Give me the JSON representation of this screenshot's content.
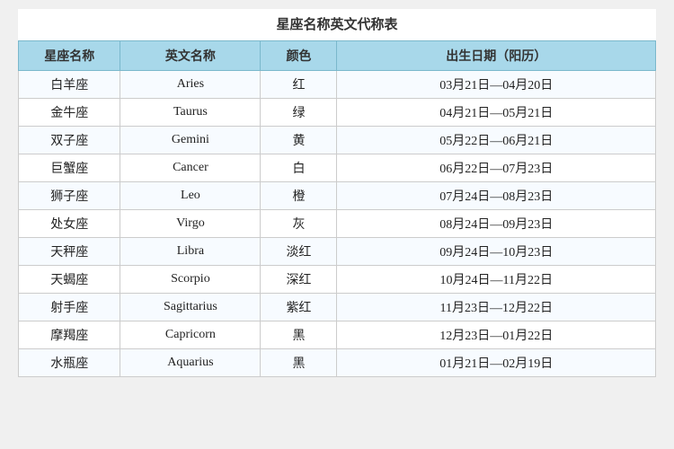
{
  "page": {
    "title": "星座名称英文代称表",
    "table": {
      "headers": [
        "星座名称",
        "英文名称",
        "颜色",
        "出生日期（阳历）"
      ],
      "rows": [
        {
          "zh": "白羊座",
          "en": "Aries",
          "color": "红",
          "date": "03月21日—04月20日"
        },
        {
          "zh": "金牛座",
          "en": "Taurus",
          "color": "绿",
          "date": "04月21日—05月21日"
        },
        {
          "zh": "双子座",
          "en": "Gemini",
          "color": "黄",
          "date": "05月22日—06月21日"
        },
        {
          "zh": "巨蟹座",
          "en": "Cancer",
          "color": "白",
          "date": "06月22日—07月23日"
        },
        {
          "zh": "狮子座",
          "en": "Leo",
          "color": "橙",
          "date": "07月24日—08月23日"
        },
        {
          "zh": "处女座",
          "en": "Virgo",
          "color": "灰",
          "date": "08月24日—09月23日"
        },
        {
          "zh": "天秤座",
          "en": "Libra",
          "color": "淡红",
          "date": "09月24日—10月23日"
        },
        {
          "zh": "天蝎座",
          "en": "Scorpio",
          "color": "深红",
          "date": "10月24日—11月22日"
        },
        {
          "zh": "射手座",
          "en": "Sagittarius",
          "color": "紫红",
          "date": "11月23日—12月22日"
        },
        {
          "zh": "摩羯座",
          "en": "Capricorn",
          "color": "黑",
          "date": "12月23日—01月22日"
        },
        {
          "zh": "水瓶座",
          "en": "Aquarius",
          "color": "黑",
          "date": "01月21日—02月19日"
        }
      ]
    }
  }
}
